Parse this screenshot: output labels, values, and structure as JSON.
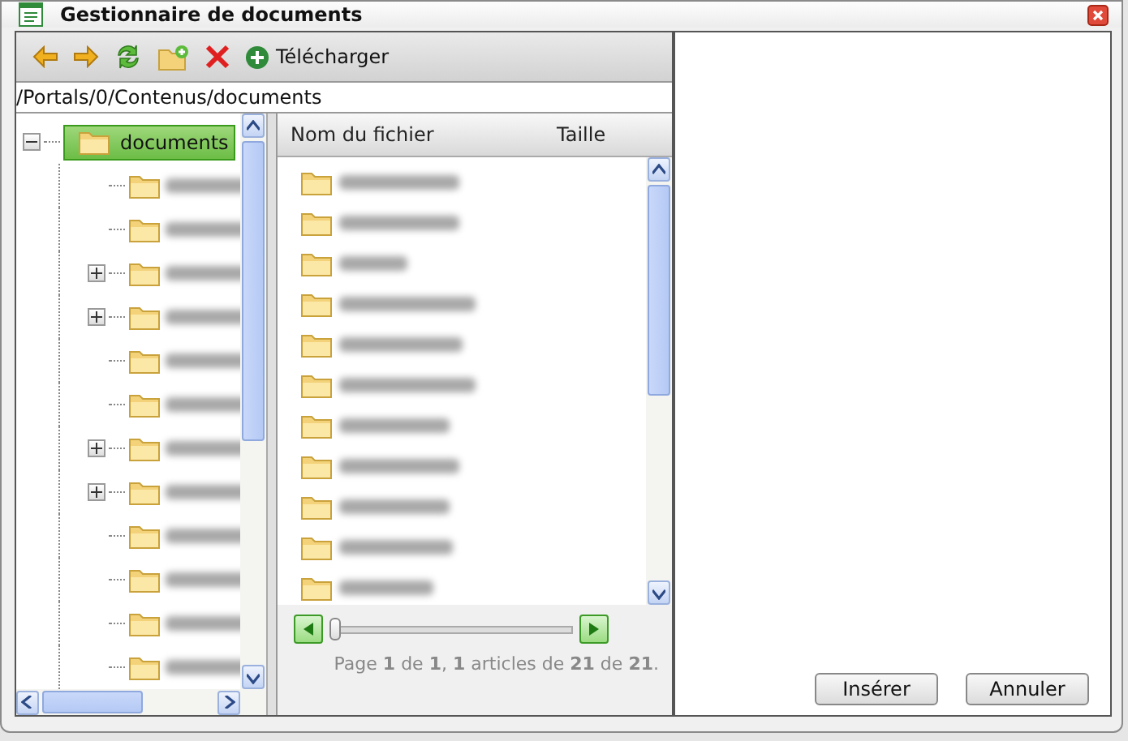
{
  "window": {
    "title": "Gestionnaire de documents"
  },
  "toolbar": {
    "upload_label": "Télécharger"
  },
  "path": "/Portals/0/Contenus/documents",
  "tree": {
    "label": "documents",
    "selected": true,
    "expanded": true,
    "children": [
      {
        "expandable": false
      },
      {
        "expandable": false
      },
      {
        "expandable": true
      },
      {
        "expandable": true
      },
      {
        "expandable": false
      },
      {
        "expandable": false
      },
      {
        "expandable": true
      },
      {
        "expandable": true
      },
      {
        "expandable": false
      },
      {
        "expandable": false
      },
      {
        "expandable": false
      },
      {
        "expandable": false
      }
    ]
  },
  "file_list": {
    "columns": [
      "Nom du fichier",
      "Taille"
    ],
    "rows": [
      {
        "kind": "folder"
      },
      {
        "kind": "folder"
      },
      {
        "kind": "folder"
      },
      {
        "kind": "folder"
      },
      {
        "kind": "folder"
      },
      {
        "kind": "folder"
      },
      {
        "kind": "folder"
      },
      {
        "kind": "folder"
      },
      {
        "kind": "folder"
      },
      {
        "kind": "folder"
      },
      {
        "kind": "folder"
      }
    ],
    "pager": {
      "level": 0,
      "text": "Page **1** de **1**, **1** articles de **21** de **21**."
    }
  },
  "buttons": [
    "Insérer",
    "Annuler"
  ]
}
